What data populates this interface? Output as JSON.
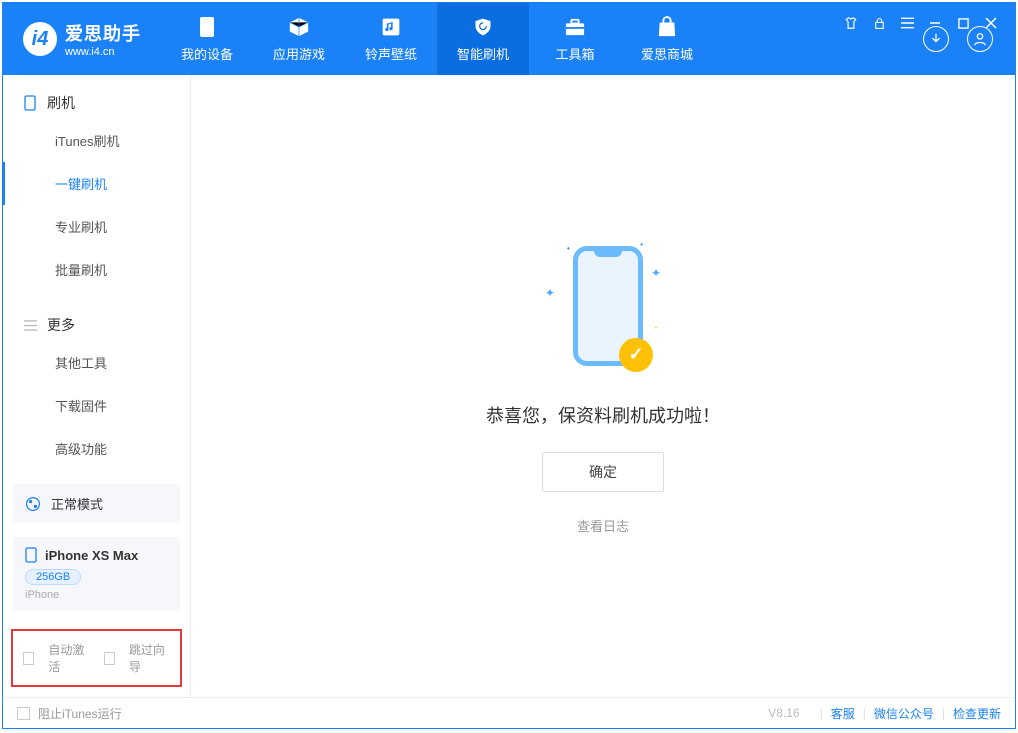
{
  "app": {
    "title": "爱思助手",
    "subtitle": "www.i4.cn"
  },
  "tabs": [
    {
      "label": "我的设备"
    },
    {
      "label": "应用游戏"
    },
    {
      "label": "铃声壁纸"
    },
    {
      "label": "智能刷机"
    },
    {
      "label": "工具箱"
    },
    {
      "label": "爱思商城"
    }
  ],
  "sidebar": {
    "section1": {
      "title": "刷机",
      "items": [
        "iTunes刷机",
        "一键刷机",
        "专业刷机",
        "批量刷机"
      ]
    },
    "section2": {
      "title": "更多",
      "items": [
        "其他工具",
        "下载固件",
        "高级功能"
      ]
    }
  },
  "mode": {
    "label": "正常模式"
  },
  "device": {
    "name": "iPhone XS Max",
    "capacity": "256GB",
    "type": "iPhone"
  },
  "options": {
    "auto_activate": "自动激活",
    "skip_guide": "跳过向导"
  },
  "main": {
    "success_title": "恭喜您，保资料刷机成功啦！",
    "ok_button": "确定",
    "view_log": "查看日志"
  },
  "footer": {
    "stop_itunes": "阻止iTunes运行",
    "version": "V8.16",
    "support": "客服",
    "wechat": "微信公众号",
    "check_update": "检查更新"
  }
}
